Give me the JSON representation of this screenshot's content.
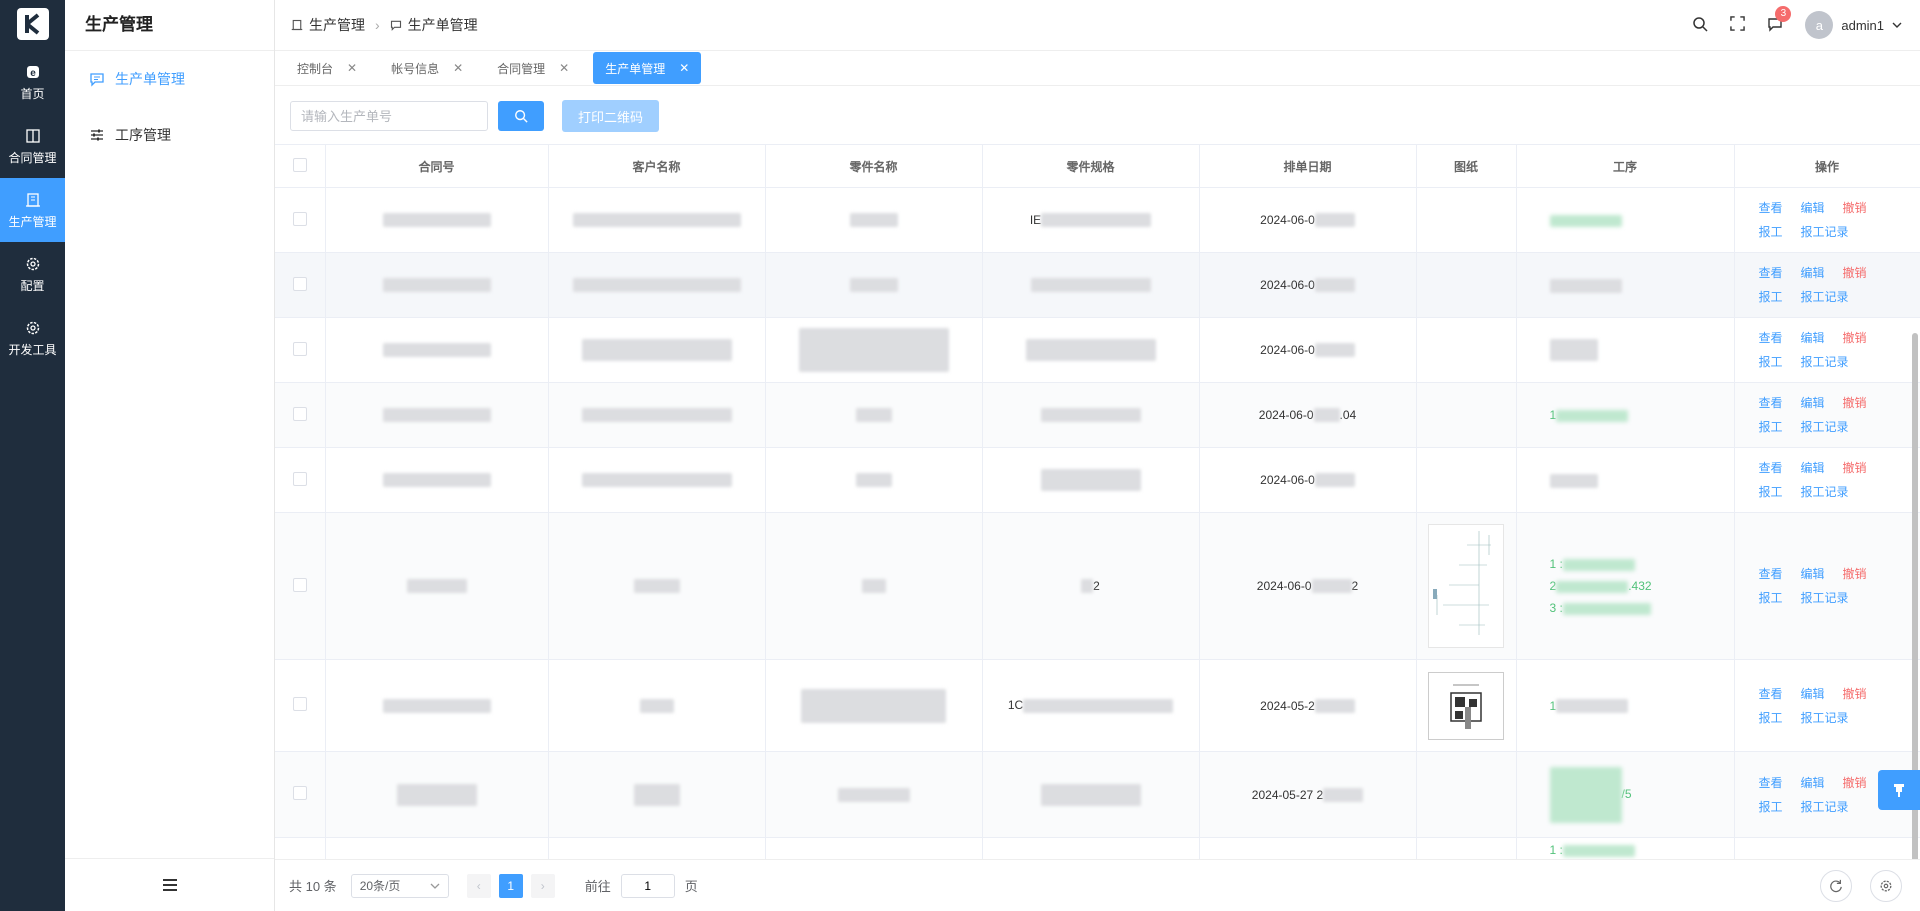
{
  "app": {
    "logo_letter": "K",
    "section_title": "生产管理"
  },
  "rail": [
    {
      "label": "首页",
      "icon": "home-icon"
    },
    {
      "label": "合同管理",
      "icon": "book-icon"
    },
    {
      "label": "生产管理",
      "icon": "building-icon"
    },
    {
      "label": "配置",
      "icon": "gear-icon"
    },
    {
      "label": "开发工具",
      "icon": "gear-icon"
    }
  ],
  "submenu": [
    {
      "label": "生产单管理",
      "icon": "message-icon"
    },
    {
      "label": "工序管理",
      "icon": "sliders-icon"
    }
  ],
  "breadcrumb": [
    "生产管理",
    "生产单管理"
  ],
  "header": {
    "user": "admin1",
    "avatar_letter": "a",
    "notification_count": "3"
  },
  "tabs": [
    {
      "label": "控制台"
    },
    {
      "label": "帐号信息"
    },
    {
      "label": "合同管理"
    },
    {
      "label": "生产单管理"
    }
  ],
  "toolbar": {
    "search_placeholder": "请输入生产单号",
    "print_label": "打印二维码"
  },
  "table": {
    "columns": [
      "合同号",
      "客户名称",
      "零件名称",
      "零件规格",
      "排单日期",
      "图纸",
      "工序",
      "操作"
    ],
    "actions": {
      "view": "查看",
      "edit": "编辑",
      "cancel": "撤销",
      "report": "报工",
      "report_log": "报工记录"
    },
    "rows": [
      {
        "spec_prefix": "IE",
        "date": "2024-06-0",
        "process": [
          ""
        ]
      },
      {
        "spec_prefix": "",
        "date": "2024-06-0",
        "process": [
          ""
        ]
      },
      {
        "spec_prefix": "",
        "date": "2024-06-0",
        "process": [
          ""
        ]
      },
      {
        "spec_prefix": "",
        "date": "2024-06-0",
        "date_suffix": ".04",
        "process": [
          "1"
        ]
      },
      {
        "spec_prefix": "",
        "date": "2024-06-0",
        "process": [
          ""
        ]
      },
      {
        "spec_prefix": "2",
        "date": "2024-06-0",
        "date_suffix": "2",
        "process": [
          "1 :",
          "2",
          "3 :"
        ],
        "process_suffix": [
          ".432"
        ]
      },
      {
        "spec_prefix": "1C",
        "date": "2024-05-2",
        "process": [
          "1"
        ]
      },
      {
        "spec_prefix": "",
        "date": "2024-05-27 2",
        "process": [
          ""
        ],
        "process_suffix_last": "/5"
      },
      {
        "spec_prefix": "",
        "date": "",
        "process": [
          "1 :"
        ]
      }
    ]
  },
  "pager": {
    "total": "共 10 条",
    "page_size": "20条/页",
    "current": "1",
    "goto_label": "前往",
    "goto_value": "1",
    "page_unit": "页"
  },
  "colors": {
    "primary": "#409eff",
    "danger": "#f56c6c",
    "rail_bg": "#1f2d3d",
    "success": "#52c27a"
  }
}
